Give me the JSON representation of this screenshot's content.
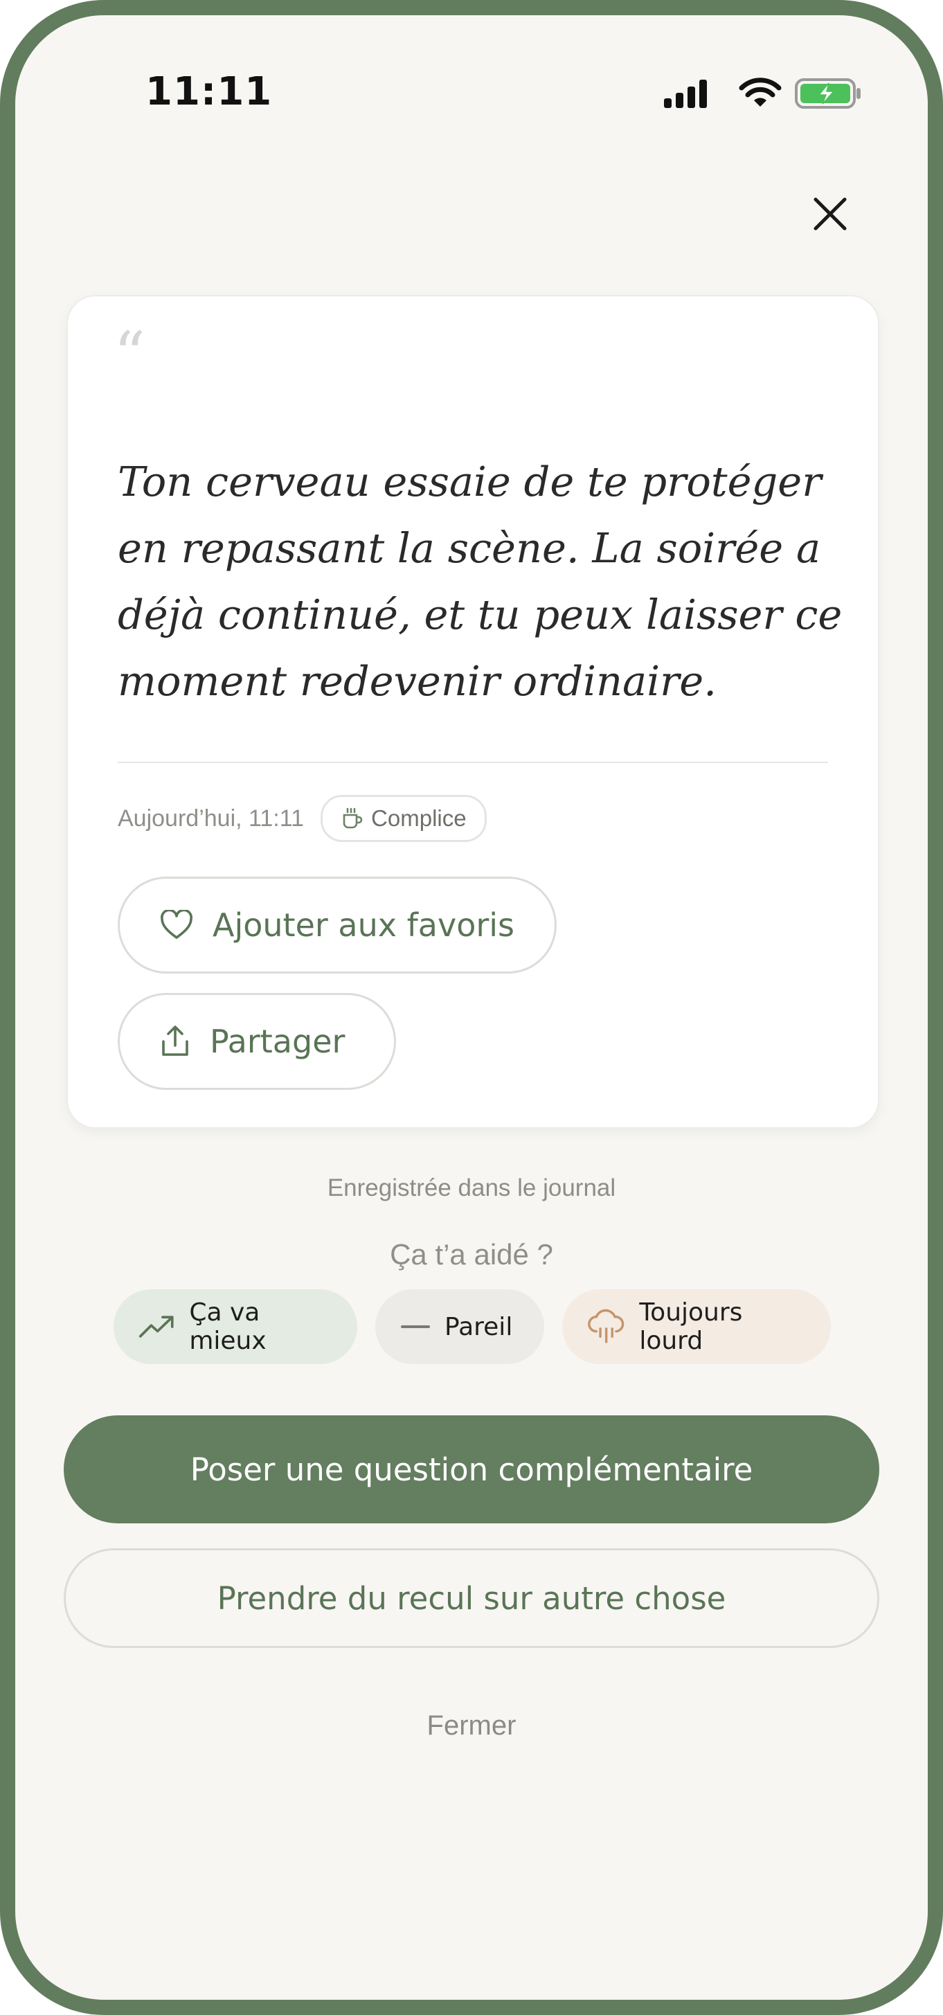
{
  "status_bar": {
    "time": "11:11",
    "icons": [
      "cellular-signal-icon",
      "wifi-icon",
      "battery-charging-icon"
    ],
    "battery_color": "#4cc05a"
  },
  "card": {
    "quote_mark": "“",
    "quote": "Ton cerveau essaie de te protéger en repassant la scène. La soirée a déjà continué, et tu peux laisser ce moment redevenir ordinaire.",
    "date": "Aujourd’hui, 11:11",
    "tag": {
      "label": "Complice",
      "icon": "coffee-cup-icon"
    },
    "favorite_button": {
      "label": "Ajouter aux favoris",
      "icon": "heart-icon"
    },
    "share_button": {
      "label": "Partager",
      "icon": "share-icon"
    }
  },
  "saved_note": "Enregistrée dans le journal",
  "feedback": {
    "question": "Ça t’a aidé ?",
    "options": [
      {
        "label": "Ça va mieux",
        "icon": "trending-up-icon"
      },
      {
        "label": "Pareil",
        "icon": "minus-icon"
      },
      {
        "label": "Toujours lourd",
        "icon": "rain-cloud-icon"
      }
    ]
  },
  "actions": {
    "primary": "Poser une question complémentaire",
    "secondary": "Prendre du recul sur autre chose",
    "close": "Fermer"
  },
  "colors": {
    "frame": "#627d5d",
    "background": "#f7f6f3",
    "accent": "#647e60",
    "accent_text": "#5a7456"
  }
}
